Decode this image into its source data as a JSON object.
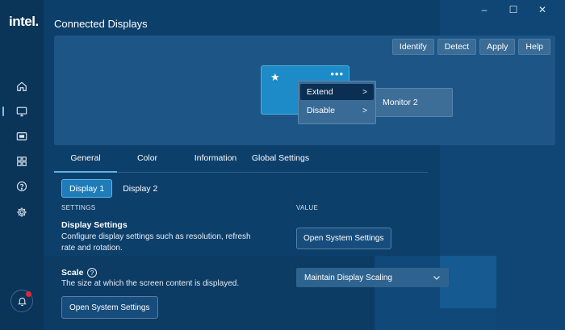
{
  "brand": {
    "logo_text": "intel."
  },
  "window_controls": {
    "minimize": "–",
    "maximize": "☐",
    "close": "✕"
  },
  "sidebar": {
    "items": [
      {
        "icon": "home-icon"
      },
      {
        "icon": "display-icon",
        "active": true
      },
      {
        "icon": "video-icon"
      },
      {
        "icon": "apps-icon"
      },
      {
        "icon": "help-icon"
      },
      {
        "icon": "settings-icon"
      }
    ],
    "notification_icon": "bell-icon"
  },
  "page": {
    "title": "Connected Displays"
  },
  "toolbar": {
    "identify": "Identify",
    "detect": "Detect",
    "apply": "Apply",
    "help": "Help"
  },
  "displays": {
    "monitor1": {
      "star": "★",
      "menu_dots": "•••"
    },
    "monitor2": {
      "label": "Monitor 2"
    },
    "context_menu": [
      {
        "label": "Extend",
        "selected": true
      },
      {
        "label": "Disable",
        "selected": false
      }
    ]
  },
  "tabs": [
    {
      "label": "General",
      "active": true
    },
    {
      "label": "Color",
      "active": false
    },
    {
      "label": "Information",
      "active": false
    },
    {
      "label": "Global Settings",
      "active": false
    }
  ],
  "subtabs": [
    {
      "label": "Display 1",
      "active": true
    },
    {
      "label": "Display 2",
      "active": false
    }
  ],
  "columns": {
    "settings": "SETTINGS",
    "value": "VALUE"
  },
  "display_settings": {
    "title": "Display Settings",
    "description": "Configure display settings such as resolution, refresh rate and rotation.",
    "button": "Open System Settings"
  },
  "scale": {
    "title": "Scale",
    "help": "?",
    "description": "The size at which the screen content is displayed.",
    "select_value": "Maintain Display Scaling",
    "bottom_button": "Open System Settings"
  },
  "colors": {
    "accent": "#1e7cb8",
    "background": "#0d3f6b",
    "sidebar": "#0a3458",
    "badge": "#e0263a"
  }
}
